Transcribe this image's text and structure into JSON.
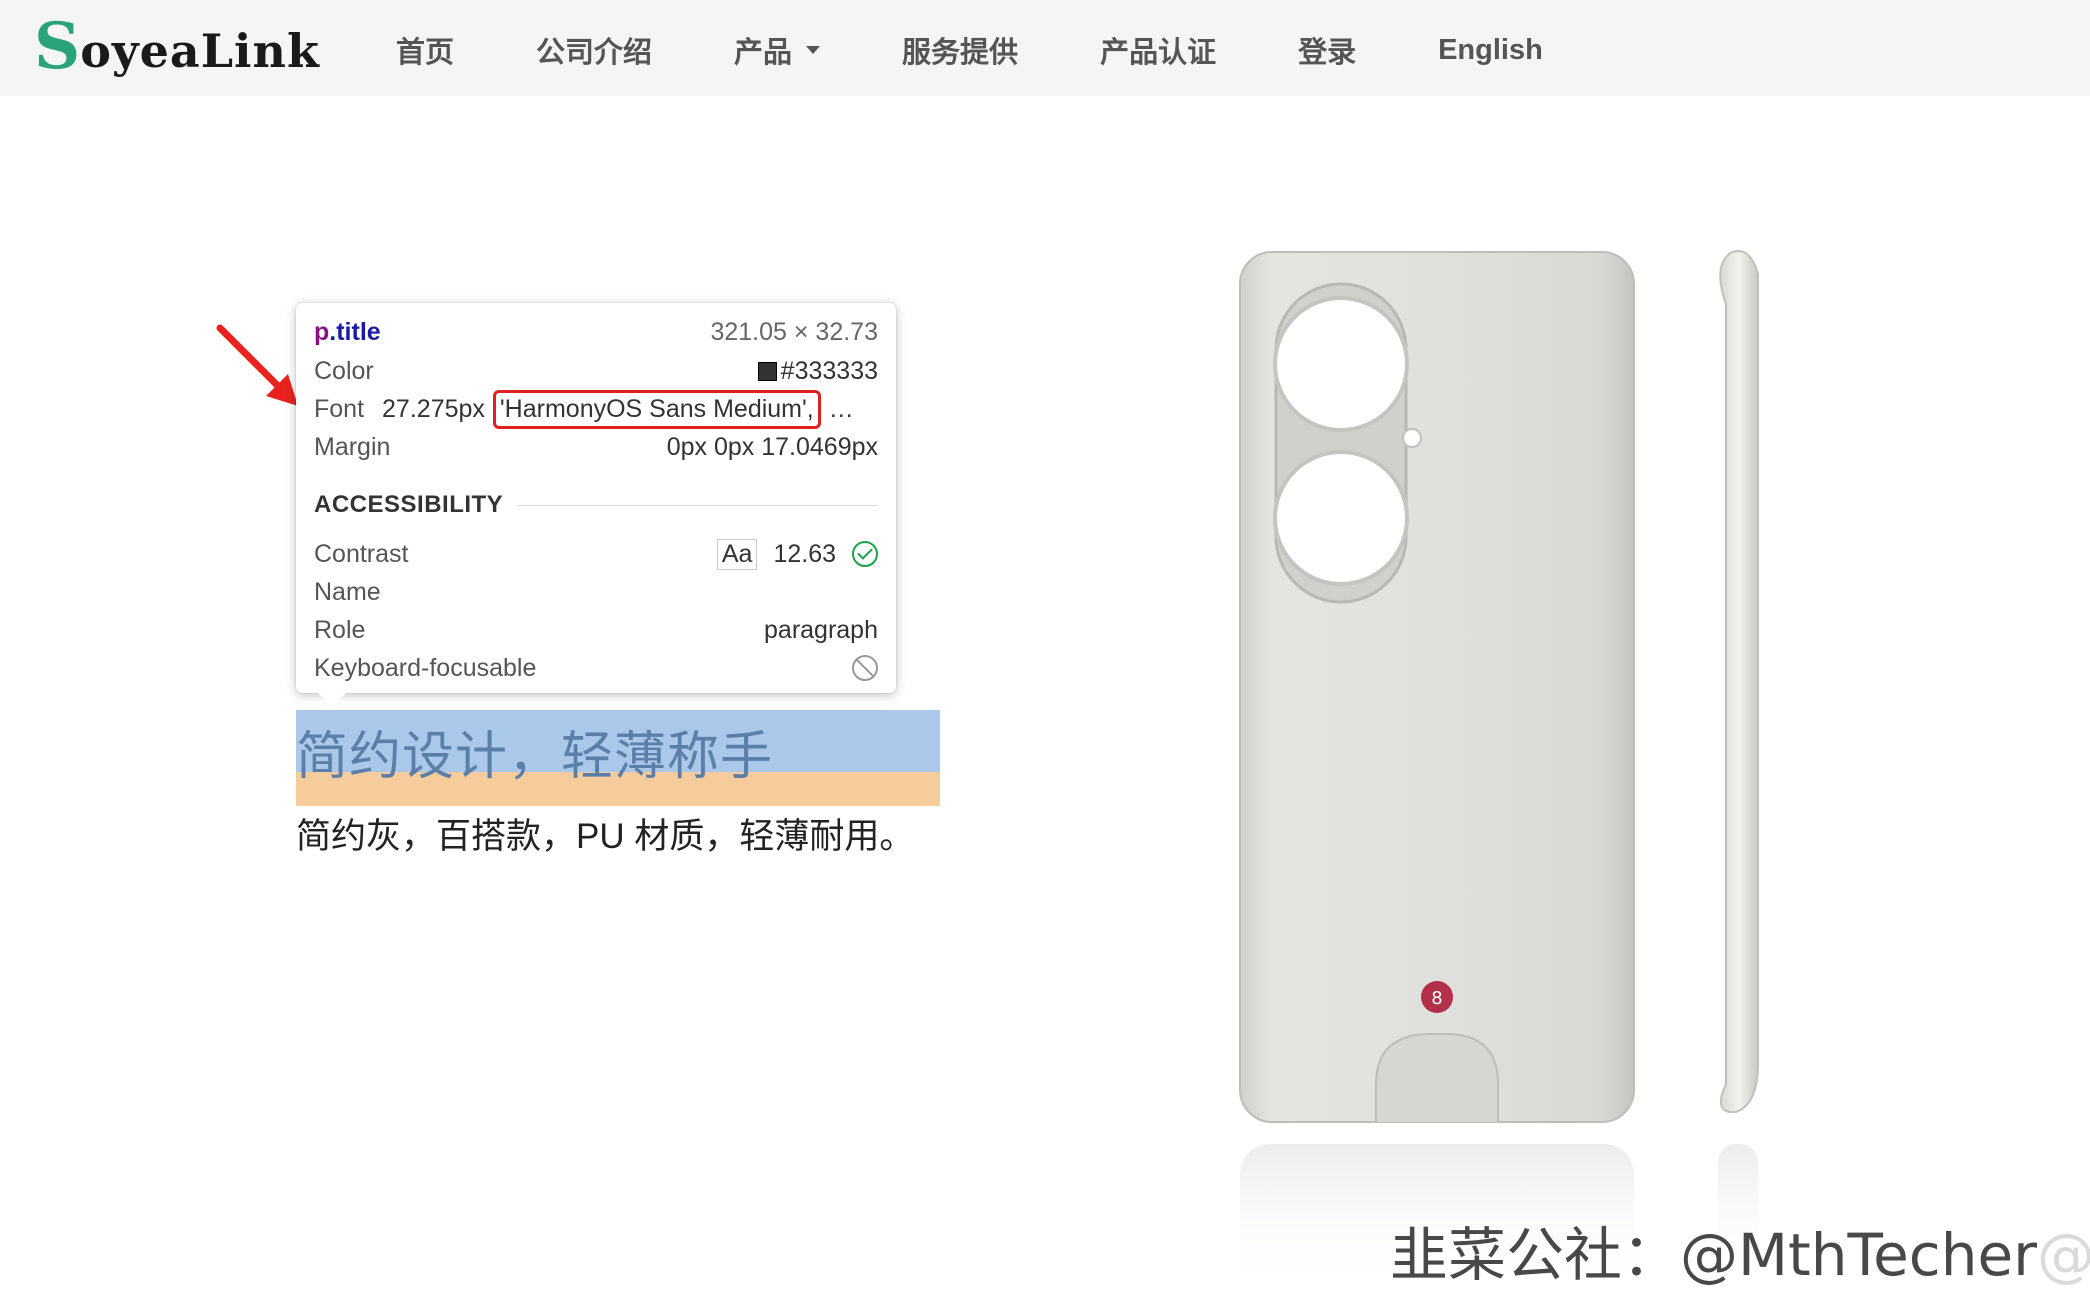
{
  "brand": {
    "logo_s": "S",
    "logo_rest": "oyeaLink",
    "accent": "#2ba37a"
  },
  "nav": {
    "items": [
      {
        "label": "首页"
      },
      {
        "label": "公司介绍"
      },
      {
        "label": "产品"
      },
      {
        "label": "服务提供"
      },
      {
        "label": "产品认证"
      },
      {
        "label": "登录"
      },
      {
        "label": "English"
      }
    ]
  },
  "inspector": {
    "selector_tag": "p",
    "selector_class": ".title",
    "dimensions": "321.05 × 32.73",
    "color_label": "Color",
    "color_value": "#333333",
    "font_label": "Font",
    "font_size": "27.275px",
    "font_name": "'HarmonyOS Sans Medium',",
    "font_more": "…",
    "margin_label": "Margin",
    "margin_value": "0px 0px 17.0469px",
    "accessibility_heading": "ACCESSIBILITY",
    "contrast_label": "Contrast",
    "contrast_sample": "Aa",
    "contrast_value": "12.63",
    "name_label": "Name",
    "role_label": "Role",
    "role_value": "paragraph",
    "keyboard_label": "Keyboard-focusable"
  },
  "content": {
    "title": "简约设计，轻薄称手",
    "subtitle": "简约灰，百搭款，PU 材质，轻薄耐用。"
  },
  "watermark": {
    "text": "韭菜公社：@MthTecher",
    "ghost": "@成都艺福"
  }
}
